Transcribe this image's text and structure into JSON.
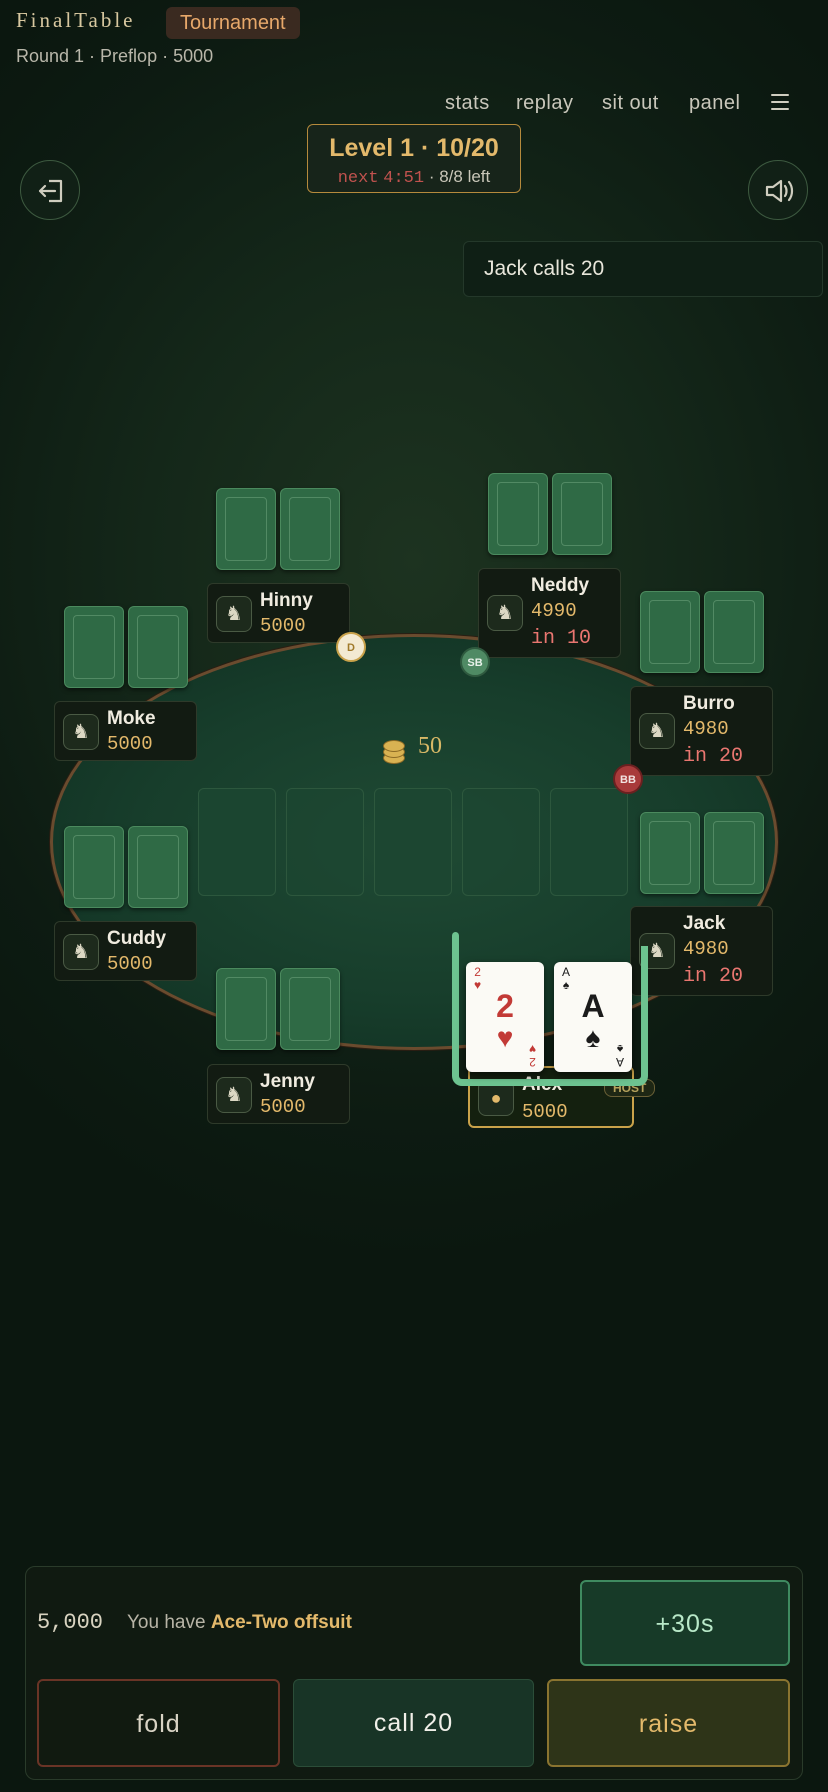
{
  "header": {
    "brand": "FinalTable",
    "mode_badge": "Tournament",
    "subtitle": "Round 1 · Preflop · 5000"
  },
  "nav": {
    "stats": "stats",
    "replay": "replay",
    "sit_out": "sit out",
    "panel": "panel"
  },
  "level": {
    "title": "Level 1 · 10/20",
    "next_label": "next",
    "timer": "4:51",
    "players_left": "· 8/8 left"
  },
  "log": {
    "last_action": "Jack calls 20"
  },
  "pot": {
    "amount": "50"
  },
  "players": {
    "hinny": {
      "name": "Hinny",
      "chips": "5000"
    },
    "neddy": {
      "name": "Neddy",
      "chips": "4990",
      "bet": "in 10"
    },
    "moke": {
      "name": "Moke",
      "chips": "5000"
    },
    "burro": {
      "name": "Burro",
      "chips": "4980",
      "bet": "in 20"
    },
    "cuddy": {
      "name": "Cuddy",
      "chips": "5000"
    },
    "jack": {
      "name": "Jack",
      "chips": "4980",
      "bet": "in 20"
    },
    "jenny": {
      "name": "Jenny",
      "chips": "5000"
    },
    "alex": {
      "name": "Alex",
      "chips": "5000",
      "badge": "HOST"
    }
  },
  "buttons_on_table": {
    "dealer": "D",
    "small_blind": "SB",
    "big_blind": "BB"
  },
  "hero_cards": [
    {
      "rank": "2",
      "suit": "♥",
      "color": "#c23a36"
    },
    {
      "rank": "A",
      "suit": "♠",
      "color": "#1b1b1b"
    }
  ],
  "action_panel": {
    "stack": "5,000",
    "hand_prefix": "You have",
    "hand_name": "Ace-Two offsuit",
    "timebank": "+30s",
    "fold": "fold",
    "call": "call 20",
    "raise": "raise"
  },
  "icons": [
    "exit-icon",
    "speaker-icon",
    "menu-icon",
    "donkey-avatar-icon",
    "person-avatar-icon",
    "chip-stack-icon"
  ]
}
